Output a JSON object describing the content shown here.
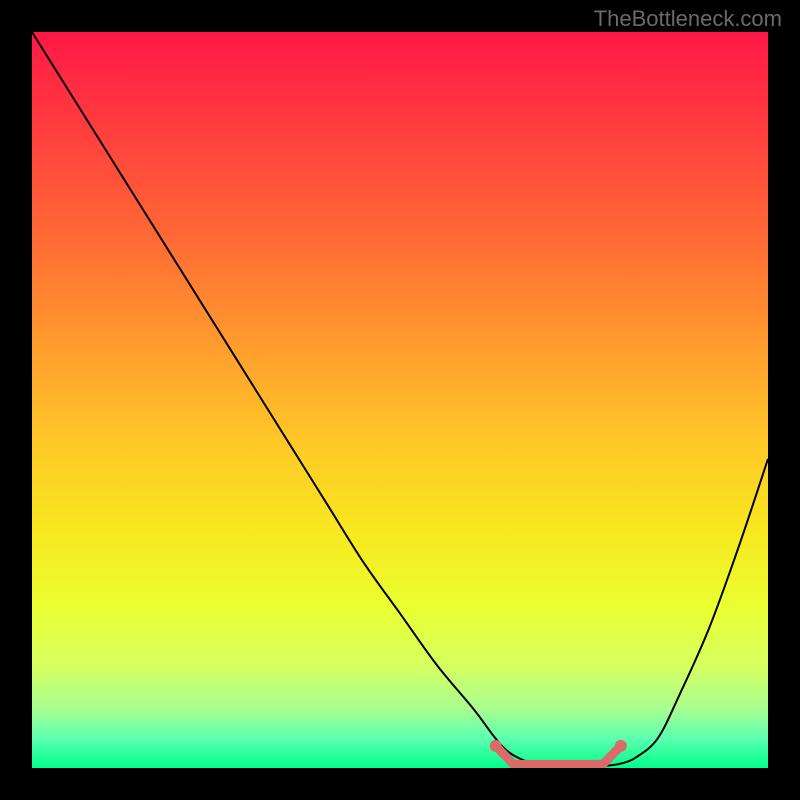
{
  "attribution": "TheBottleneck.com",
  "chart_data": {
    "type": "line",
    "title": "",
    "xlabel": "",
    "ylabel": "",
    "xlim": [
      0,
      100
    ],
    "ylim": [
      0,
      100
    ],
    "x": [
      0,
      5,
      10,
      15,
      20,
      25,
      30,
      35,
      40,
      45,
      50,
      55,
      60,
      63,
      65,
      68,
      70,
      73,
      76,
      78,
      80,
      82,
      85,
      88,
      92,
      96,
      100
    ],
    "values": [
      100,
      92,
      84,
      76,
      68,
      60,
      52,
      44,
      36,
      28,
      21,
      14,
      8,
      4,
      2,
      0.6,
      0.3,
      0.2,
      0.2,
      0.3,
      0.6,
      1.4,
      4,
      10,
      19,
      30,
      42
    ],
    "marker_region": {
      "x_start": 63,
      "x_end": 80,
      "color": "#d96b6b",
      "points_y": [
        3.0,
        0.5,
        0.5,
        0.5,
        0.5,
        0.5,
        0.5,
        3.0
      ]
    },
    "gradient_colors": {
      "top": "#ff1846",
      "mid_upper": "#ff9a2e",
      "mid": "#f7e81f",
      "mid_lower": "#d6ff60",
      "bottom": "#00ff88"
    }
  }
}
